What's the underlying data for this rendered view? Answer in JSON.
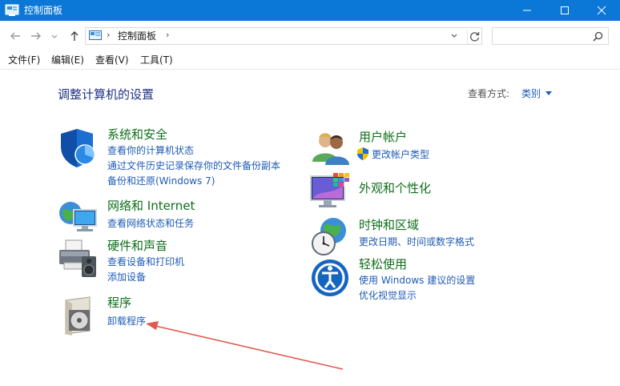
{
  "window": {
    "title": "控制面板"
  },
  "address": {
    "crumb": "控制面板",
    "search_placeholder": ""
  },
  "menu": [
    "文件(F)",
    "编辑(E)",
    "查看(V)",
    "工具(T)"
  ],
  "content": {
    "page_title": "调整计算机的设置",
    "view_label": "查看方式:",
    "view_value": "类别"
  },
  "categories": [
    {
      "title": "系统和安全",
      "icon": "shield-icon",
      "links": [
        "查看你的计算机状态",
        "通过文件历史记录保存你的文件备份副本",
        "备份和还原(Windows 7)"
      ]
    },
    {
      "title": "网络和 Internet",
      "icon": "network-globe-icon",
      "links": [
        "查看网络状态和任务"
      ]
    },
    {
      "title": "硬件和声音",
      "icon": "printer-speaker-icon",
      "links": [
        "查看设备和打印机",
        "添加设备"
      ]
    },
    {
      "title": "程序",
      "icon": "programs-disc-icon",
      "links": [
        "卸载程序"
      ]
    },
    {
      "title": "用户帐户",
      "icon": "users-icon",
      "links": [
        "更改帐户类型"
      ]
    },
    {
      "title": "外观和个性化",
      "icon": "monitor-palette-icon",
      "links": []
    },
    {
      "title": "时钟和区域",
      "icon": "clock-globe-icon",
      "links": [
        "更改日期、时间或数字格式"
      ]
    },
    {
      "title": "轻松使用",
      "icon": "ease-of-access-icon",
      "links": [
        "使用 Windows 建议的设置",
        "优化视觉显示"
      ]
    }
  ],
  "colors": {
    "titlebar": "#0b78d7",
    "heading": "#0d6e1a",
    "link": "#1e5bb8",
    "page_title": "#1e3287",
    "annotation_arrow": "#e05a4e"
  }
}
